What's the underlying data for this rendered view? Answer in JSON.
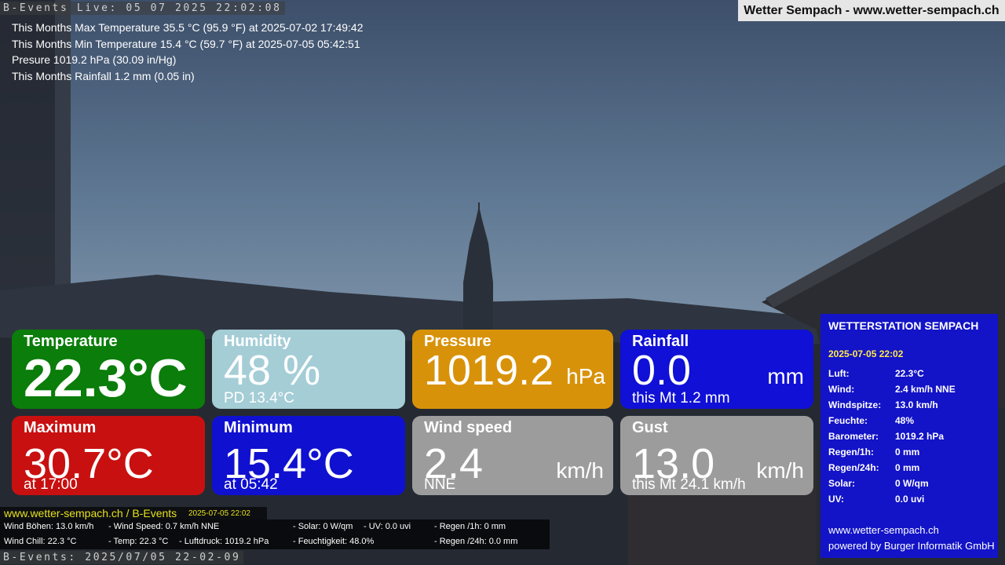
{
  "camera": {
    "title_top": "B-Events Live: 05 07 2025 22:02:08",
    "title_bottom": "B-Events: 2025/07/05 22-02-09"
  },
  "site_banner": "Wetter Sempach - www.wetter-sempach.ch",
  "stats": [
    "This Months Max Temperature 35.5 °C (95.9 °F) at 2025-07-02 17:49:42",
    "This Months Min Temperature 15.4 °C (59.7 °F) at 2025-07-05 05:42:51",
    "Presure 1019.2 hPa (30.09 in/Hg)",
    "This Months Rainfall 1.2 mm (0.05 in)"
  ],
  "tiles": {
    "temperature": {
      "label": "Temperature",
      "value": "22.3°C",
      "color": "#0a7d0a"
    },
    "humidity": {
      "label": "Humidity",
      "value": "48 %",
      "sub": "PD 13.4°C",
      "color": "#a4cdd6"
    },
    "pressure": {
      "label": "Pressure",
      "value": "1019.2",
      "unit": "hPa",
      "color": "#d8920a"
    },
    "rainfall": {
      "label": "Rainfall",
      "value": "0.0",
      "unit": "mm",
      "sub": "this Mt 1.2 mm",
      "color": "#1010d6"
    },
    "maximum": {
      "label": "Maximum",
      "value": "30.7°C",
      "sub": "at 17:00",
      "color": "#c81010"
    },
    "minimum": {
      "label": "Minimum",
      "value": "15.4°C",
      "sub": "at 05:42",
      "color": "#1010d0"
    },
    "wind": {
      "label": "Wind speed",
      "value": "2.4",
      "unit": "km/h",
      "sub": "NNE",
      "color": "#9c9c9c"
    },
    "gust": {
      "label": "Gust",
      "value": "13.0",
      "unit": "km/h",
      "sub": "this Mt 24.1 km/h",
      "color": "#9c9c9c"
    }
  },
  "panel": {
    "title": "WETTERSTATION SEMPACH",
    "date": "2025-07-05 22:02",
    "rows": [
      {
        "k": "Luft:",
        "v": "22.3°C"
      },
      {
        "k": "Wind:",
        "v": "2.4 km/h  NNE"
      },
      {
        "k": "Windspitze:",
        "v": "13.0 km/h"
      },
      {
        "k": "Feuchte:",
        "v": "48%"
      },
      {
        "k": "Barometer:",
        "v": "1019.2 hPa"
      },
      {
        "k": "Regen/1h:",
        "v": "0 mm"
      },
      {
        "k": "Regen/24h:",
        "v": "0 mm"
      },
      {
        "k": "Solar:",
        "v": "0 W/qm"
      },
      {
        "k": "UV:",
        "v": "0.0 uvi"
      }
    ],
    "footer_site": "www.wetter-sempach.ch",
    "footer_credit": "powered by Burger Informatik GmbH"
  },
  "ticker": {
    "site": "www.wetter-sempach.ch / B-Events",
    "stamp": "2025-07-05 22:02",
    "items": [
      "Wind Böhen: 13.0 km/h",
      "- Wind Speed: 0.7 km/h NNE",
      "- Solar: 0 W/qm",
      "- UV: 0.0 uvi",
      "- Regen /1h:   0 mm",
      "Wind Chill: 22.3 °C",
      "- Temp: 22.3 °C",
      "- Luftdruck: 1019.2 hPa",
      "- Feuchtigkeit: 48.0%",
      "- Regen /24h: 0.0 mm"
    ]
  }
}
